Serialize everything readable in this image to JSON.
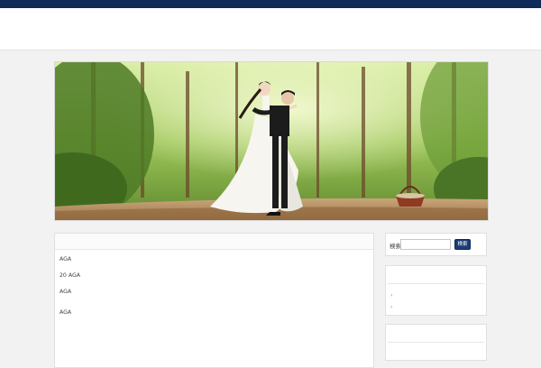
{
  "topbar": {
    "text": ""
  },
  "header": {
    "site_title": ""
  },
  "hero": {
    "alt": ""
  },
  "main": {
    "heading": "",
    "paragraphs": [
      {
        "text": "AGA",
        "gap": false
      },
      {
        "text": "",
        "gap": false
      },
      {
        "text": "20 AGA",
        "gap": false
      },
      {
        "text": "",
        "gap": false
      },
      {
        "text": "AGA",
        "gap": false
      },
      {
        "text": "",
        "gap": true
      },
      {
        "text": "AGA",
        "gap": false
      }
    ]
  },
  "sidebar": {
    "search": {
      "label": "検索:",
      "placeholder": "",
      "button": "検索"
    },
    "recent": {
      "title": "",
      "items": [
        "",
        ""
      ]
    },
    "archive": {
      "title": ""
    }
  },
  "colors": {
    "topbar": "#0f2b57",
    "button": "#1b3d73",
    "background": "#f2f2f2"
  }
}
